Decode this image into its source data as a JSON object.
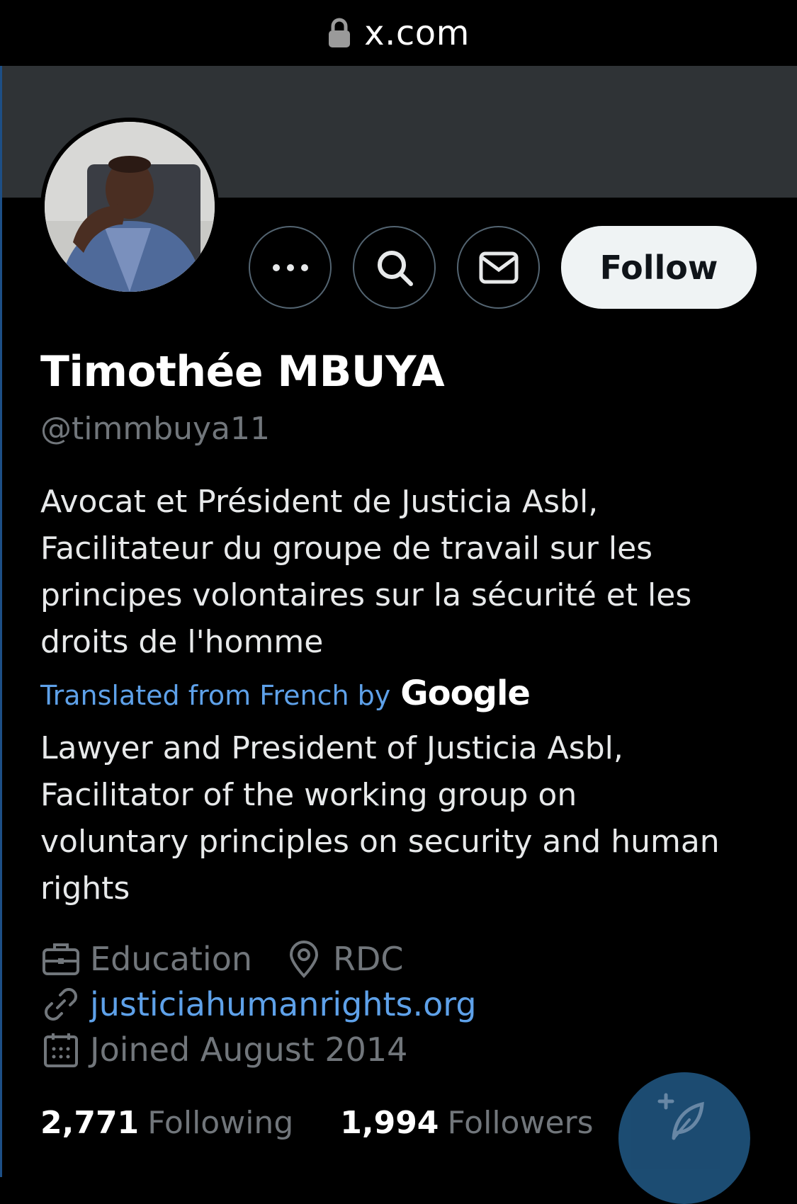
{
  "browser": {
    "url": "x.com"
  },
  "profile": {
    "name": "Timothée MBUYA",
    "handle": "@timmbuya11",
    "follow_label": "Follow",
    "bio_original": "Avocat et Président de Justicia Asbl,\nFacilitateur du groupe de travail sur les\nprincipes volontaires sur la sécurité et les\ndroits de l'homme",
    "translated_label": "Translated from French by",
    "translator_brand": "Google",
    "bio_translated": "Lawyer and President of Justicia Asbl,\nFacilitator of the working group on\nvoluntary principles on security and human\nrights",
    "category": "Education",
    "location": "RDC",
    "website": "justiciahumanrights.org",
    "joined": "Joined August 2014",
    "following_count": "2,771",
    "following_label": "Following",
    "followers_count": "1,994",
    "followers_label": "Followers"
  },
  "icons": {
    "more": "more-icon",
    "search": "search-icon",
    "message": "envelope-icon",
    "category": "briefcase-icon",
    "location": "location-pin-icon",
    "website": "link-icon",
    "joined": "calendar-icon",
    "compose": "compose-feather-icon"
  },
  "colors": {
    "background": "#000000",
    "banner": "#2f3336",
    "link": "#5ea1e9",
    "muted": "#71767b",
    "follow_bg": "#eff3f4",
    "fab": "#1e5078"
  }
}
